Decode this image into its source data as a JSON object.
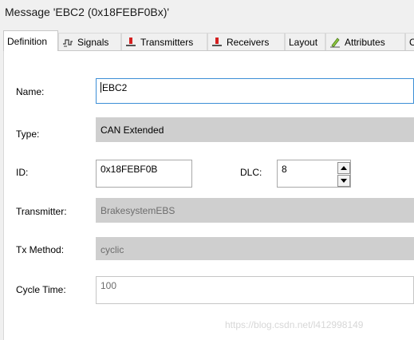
{
  "window": {
    "title": "Message 'EBC2 (0x18FEBF0Bx)'"
  },
  "tabs": [
    {
      "label": "Definition",
      "icon": "none",
      "active": true
    },
    {
      "label": "Signals",
      "icon": "signals-icon",
      "active": false
    },
    {
      "label": "Transmitters",
      "icon": "transmitter-node-icon",
      "active": false
    },
    {
      "label": "Receivers",
      "icon": "receiver-node-icon",
      "active": false
    },
    {
      "label": "Layout",
      "icon": "none",
      "active": false
    },
    {
      "label": "Attributes",
      "icon": "attributes-pencil-icon",
      "active": false
    },
    {
      "label": "C",
      "icon": "none",
      "active": false
    }
  ],
  "form": {
    "name": {
      "label": "Name:",
      "value": "EBC2"
    },
    "type": {
      "label": "Type:",
      "value": "CAN Extended"
    },
    "id": {
      "label": "ID:",
      "value": "0x18FEBF0B"
    },
    "dlc": {
      "label": "DLC:",
      "value": "8"
    },
    "transmitter": {
      "label": "Transmitter:",
      "value": "BrakesystemEBS"
    },
    "tx_method": {
      "label": "Tx Method:",
      "value": "cyclic"
    },
    "cycle_time": {
      "label": "Cycle Time:",
      "value": "100"
    }
  },
  "watermark": "https://blog.csdn.net/l412998149",
  "colors": {
    "focus_border": "#3c8ed6",
    "node_icon_red": "#d42020",
    "disabled_fill": "#cfcfcf"
  }
}
